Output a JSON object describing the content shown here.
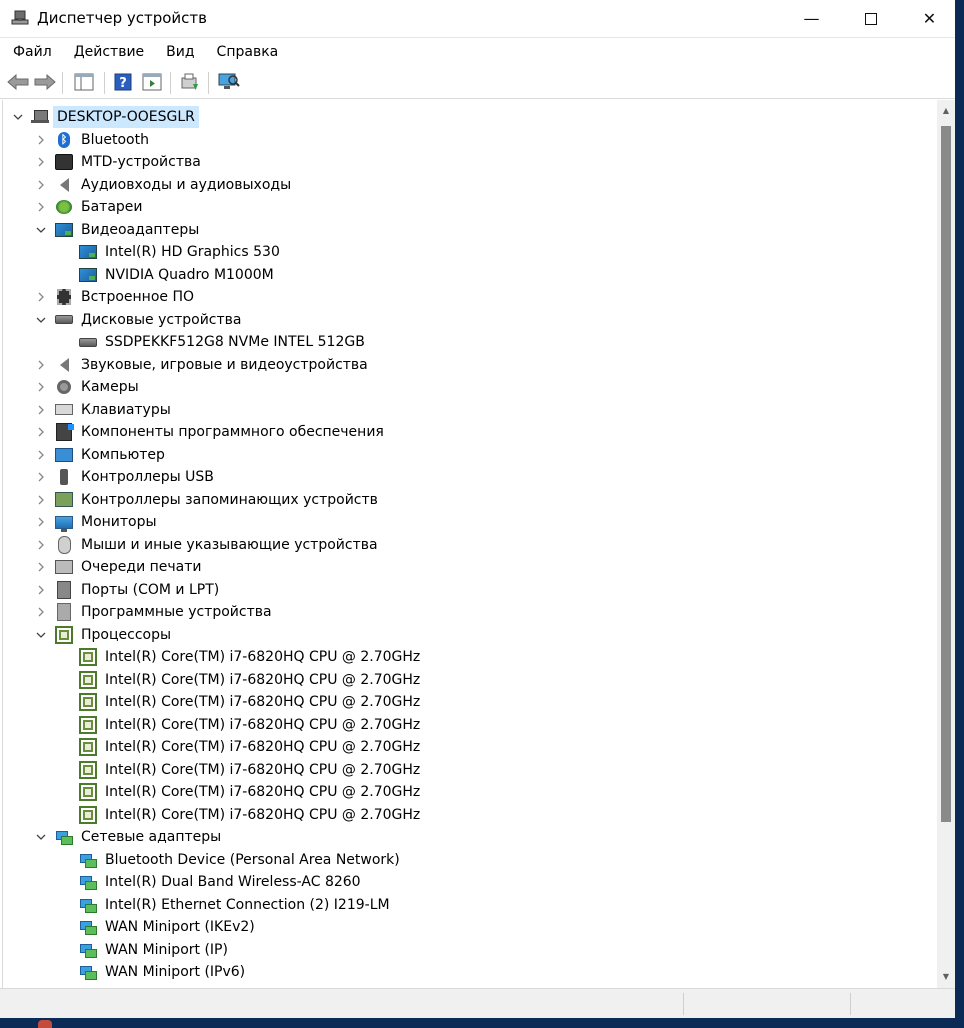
{
  "window": {
    "title": "Диспетчер устройств",
    "min_glyph": "—",
    "close_glyph": "✕"
  },
  "menu": [
    "Файл",
    "Действие",
    "Вид",
    "Справка"
  ],
  "toolbar": [
    {
      "name": "back-button",
      "icon": "arrow-left-icon"
    },
    {
      "name": "forward-button",
      "icon": "arrow-right-icon"
    },
    {
      "name": "show-hide-console-tree-button",
      "icon": "console-tree-icon"
    },
    {
      "name": "help-button",
      "icon": "help-icon"
    },
    {
      "name": "action-pane-button",
      "icon": "action-pane-icon"
    },
    {
      "name": "update-driver-button",
      "icon": "update-driver-icon"
    },
    {
      "name": "scan-hardware-button",
      "icon": "scan-monitor-icon"
    }
  ],
  "tree": [
    {
      "level": 0,
      "label": "DESKTOP-OOESGLR",
      "icon": "computer-icon",
      "chevron": "expanded",
      "selected": true
    },
    {
      "level": 1,
      "label": "Bluetooth",
      "icon": "bluetooth-icon",
      "chevron": "collapsed"
    },
    {
      "level": 1,
      "label": "MTD-устройства",
      "icon": "mtd-icon",
      "chevron": "collapsed"
    },
    {
      "level": 1,
      "label": "Аудиовходы и аудиовыходы",
      "icon": "speaker-icon",
      "chevron": "collapsed"
    },
    {
      "level": 1,
      "label": "Батареи",
      "icon": "battery-icon",
      "chevron": "collapsed"
    },
    {
      "level": 1,
      "label": "Видеоадаптеры",
      "icon": "display-adapter-icon",
      "chevron": "expanded"
    },
    {
      "level": 2,
      "label": "Intel(R) HD Graphics 530",
      "icon": "display-adapter-icon",
      "chevron": "none"
    },
    {
      "level": 2,
      "label": "NVIDIA Quadro M1000M",
      "icon": "display-adapter-icon",
      "chevron": "none"
    },
    {
      "level": 1,
      "label": "Встроенное ПО",
      "icon": "firmware-icon",
      "chevron": "collapsed"
    },
    {
      "level": 1,
      "label": "Дисковые устройства",
      "icon": "disk-icon",
      "chevron": "expanded"
    },
    {
      "level": 2,
      "label": "SSDPEKKF512G8 NVMe INTEL 512GB",
      "icon": "disk-icon",
      "chevron": "none"
    },
    {
      "level": 1,
      "label": "Звуковые, игровые и видеоустройства",
      "icon": "speaker-icon",
      "chevron": "collapsed"
    },
    {
      "level": 1,
      "label": "Камеры",
      "icon": "camera-icon",
      "chevron": "collapsed"
    },
    {
      "level": 1,
      "label": "Клавиатуры",
      "icon": "keyboard-icon",
      "chevron": "collapsed"
    },
    {
      "level": 1,
      "label": "Компоненты программного обеспечения",
      "icon": "software-component-icon",
      "chevron": "collapsed"
    },
    {
      "level": 1,
      "label": "Компьютер",
      "icon": "computer-monitor-icon",
      "chevron": "collapsed"
    },
    {
      "level": 1,
      "label": "Контроллеры USB",
      "icon": "usb-icon",
      "chevron": "collapsed"
    },
    {
      "level": 1,
      "label": "Контроллеры запоминающих устройств",
      "icon": "storage-controller-icon",
      "chevron": "collapsed"
    },
    {
      "level": 1,
      "label": "Мониторы",
      "icon": "monitor-icon",
      "chevron": "collapsed"
    },
    {
      "level": 1,
      "label": "Мыши и иные указывающие устройства",
      "icon": "mouse-icon",
      "chevron": "collapsed"
    },
    {
      "level": 1,
      "label": "Очереди печати",
      "icon": "printer-icon",
      "chevron": "collapsed"
    },
    {
      "level": 1,
      "label": "Порты (COM и LPT)",
      "icon": "port-icon",
      "chevron": "collapsed"
    },
    {
      "level": 1,
      "label": "Программные устройства",
      "icon": "software-device-icon",
      "chevron": "collapsed"
    },
    {
      "level": 1,
      "label": "Процессоры",
      "icon": "cpu-icon",
      "chevron": "expanded"
    },
    {
      "level": 2,
      "label": "Intel(R) Core(TM) i7-6820HQ CPU @ 2.70GHz",
      "icon": "cpu-icon",
      "chevron": "none"
    },
    {
      "level": 2,
      "label": "Intel(R) Core(TM) i7-6820HQ CPU @ 2.70GHz",
      "icon": "cpu-icon",
      "chevron": "none"
    },
    {
      "level": 2,
      "label": "Intel(R) Core(TM) i7-6820HQ CPU @ 2.70GHz",
      "icon": "cpu-icon",
      "chevron": "none"
    },
    {
      "level": 2,
      "label": "Intel(R) Core(TM) i7-6820HQ CPU @ 2.70GHz",
      "icon": "cpu-icon",
      "chevron": "none"
    },
    {
      "level": 2,
      "label": "Intel(R) Core(TM) i7-6820HQ CPU @ 2.70GHz",
      "icon": "cpu-icon",
      "chevron": "none"
    },
    {
      "level": 2,
      "label": "Intel(R) Core(TM) i7-6820HQ CPU @ 2.70GHz",
      "icon": "cpu-icon",
      "chevron": "none"
    },
    {
      "level": 2,
      "label": "Intel(R) Core(TM) i7-6820HQ CPU @ 2.70GHz",
      "icon": "cpu-icon",
      "chevron": "none"
    },
    {
      "level": 2,
      "label": "Intel(R) Core(TM) i7-6820HQ CPU @ 2.70GHz",
      "icon": "cpu-icon",
      "chevron": "none"
    },
    {
      "level": 1,
      "label": "Сетевые адаптеры",
      "icon": "network-adapter-icon",
      "chevron": "expanded"
    },
    {
      "level": 2,
      "label": "Bluetooth Device (Personal Area Network)",
      "icon": "network-adapter-icon",
      "chevron": "none"
    },
    {
      "level": 2,
      "label": "Intel(R) Dual Band Wireless-AC 8260",
      "icon": "network-adapter-icon",
      "chevron": "none"
    },
    {
      "level": 2,
      "label": "Intel(R) Ethernet Connection (2) I219-LM",
      "icon": "network-adapter-icon",
      "chevron": "none"
    },
    {
      "level": 2,
      "label": "WAN Miniport (IKEv2)",
      "icon": "network-adapter-icon",
      "chevron": "none"
    },
    {
      "level": 2,
      "label": "WAN Miniport (IP)",
      "icon": "network-adapter-icon",
      "chevron": "none"
    },
    {
      "level": 2,
      "label": "WAN Miniport (IPv6)",
      "icon": "network-adapter-icon",
      "chevron": "none"
    }
  ],
  "colors": {
    "selection": "#cce8ff",
    "frame": "#0b2a55"
  }
}
